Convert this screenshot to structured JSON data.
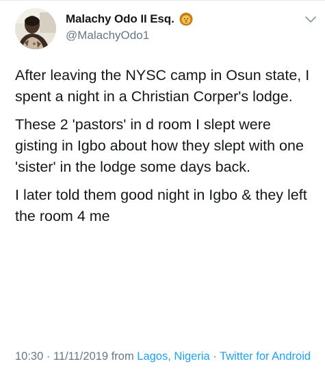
{
  "header": {
    "display_name": "Malachy Odo II Esq.",
    "emoji_icon": "lion-face-icon",
    "handle": "@MalachyOdo1",
    "menu_icon": "chevron-down-icon"
  },
  "tweet": {
    "paragraphs": [
      "After leaving the NYSC camp in Osun state, I spent a night in a Christian Corper's lodge.",
      "These 2 'pastors' in d room I slept were gisting in Igbo about how they slept with one 'sister' in the lodge some days back.",
      "I later told them good night in Igbo & they left the room 4 me"
    ]
  },
  "meta": {
    "time": "10:30",
    "separator": " · ",
    "date": "11/11/2019",
    "from_text": " from ",
    "location": "Lagos, Nigeria",
    "source": "Twitter for Android"
  },
  "colors": {
    "text": "#14171a",
    "secondary": "#657786",
    "link": "#1da1f2"
  }
}
